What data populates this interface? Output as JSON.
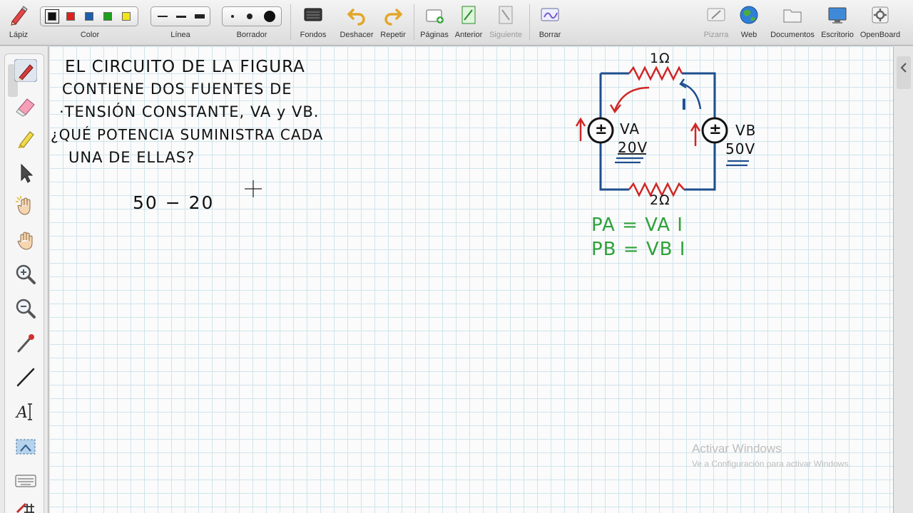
{
  "toolbar": {
    "lapiz": "Lápiz",
    "color": "Color",
    "linea": "Línea",
    "borrador": "Borrador",
    "fondos": "Fondos",
    "deshacer": "Deshacer",
    "repetir": "Repetir",
    "paginas": "Páginas",
    "anterior": "Anterior",
    "siguiente": "Siguiente",
    "borrar": "Borrar",
    "pizarra": "Pizarra",
    "web": "Web",
    "documentos": "Documentos",
    "escritorio": "Escritorio",
    "openboard": "OpenBoard",
    "colors": [
      "#111111",
      "#e02020",
      "#1d5ea8",
      "#1ea01e",
      "#f2e41a"
    ]
  },
  "board": {
    "problem": [
      "EL CIRCUITO DE LA FIGURA",
      "CONTIENE DOS FUENTES DE",
      "·TENSIÓN CONSTANTE, VA y VB.",
      "¿QUÉ POTENCIA SUMINISTRA CADA",
      "UNA DE ELLAS?"
    ],
    "work": "50 − 20",
    "circuit": {
      "r_top": "1Ω",
      "r_bottom": "2Ω",
      "va_name": "VA",
      "va_value": "20V",
      "vb_name": "VB",
      "vb_value": "50V",
      "current": "I",
      "source_symbol": "±"
    },
    "formulas": [
      "PA = VA I",
      "PB = VB I"
    ]
  },
  "watermark": {
    "title": "Activar Windows",
    "subtitle": "Ve a Configuración para activar Windows."
  }
}
